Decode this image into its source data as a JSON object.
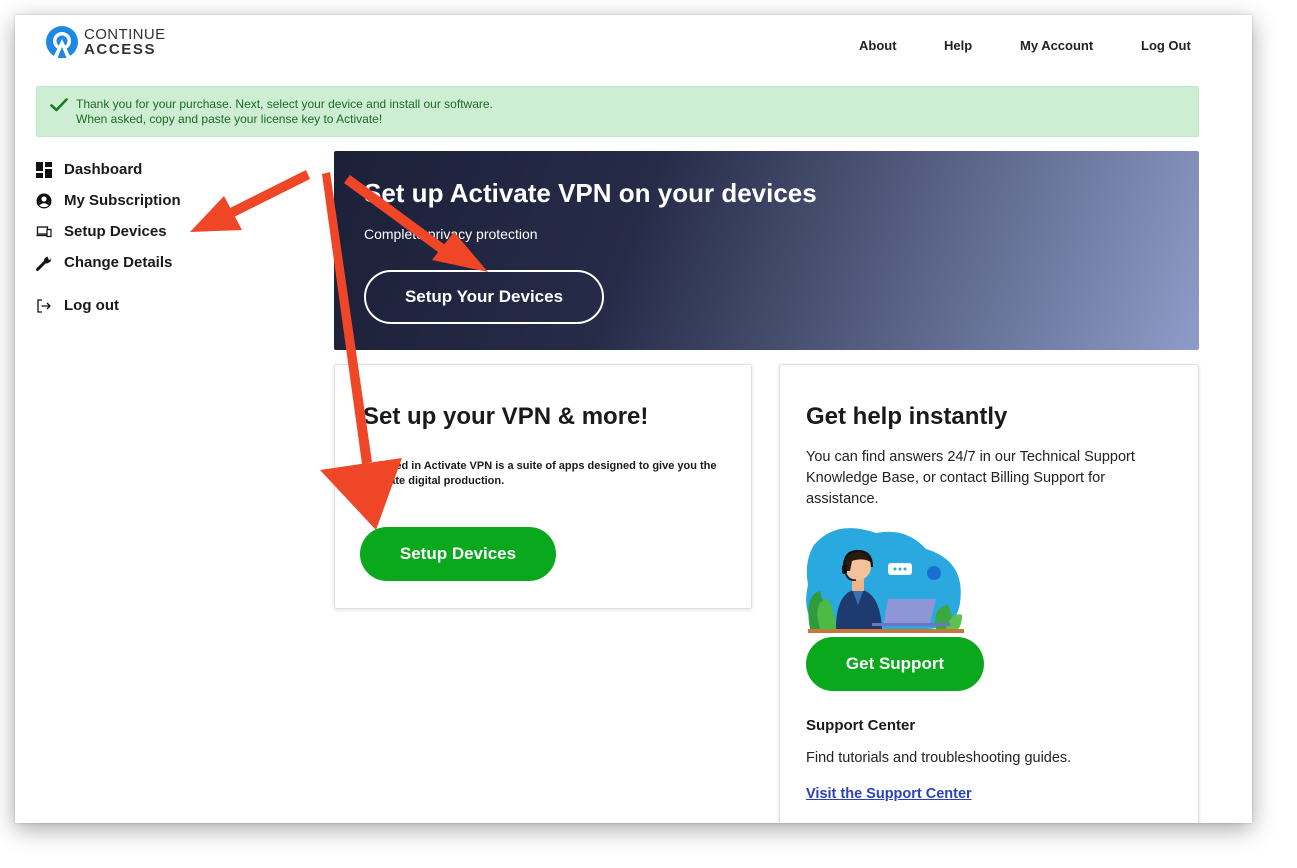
{
  "brand": {
    "line1": "CONTINUE",
    "line2": "ACCESS",
    "accent_color": "#1e88e5"
  },
  "top_nav": {
    "about": "About",
    "help": "Help",
    "my_account": "My Account",
    "log_out": "Log Out"
  },
  "alert": {
    "icon": "checkmark-icon",
    "line1": "Thank you for your purchase. Next, select your device and install our software.",
    "line2": "When asked, copy and paste your license key to Activate!",
    "color": "#cdeed3"
  },
  "sidebar": {
    "items": [
      {
        "label": "Dashboard",
        "icon": "dashboard-icon"
      },
      {
        "label": "My Subscription",
        "icon": "user-circle-icon"
      },
      {
        "label": "Setup Devices",
        "icon": "devices-icon"
      },
      {
        "label": "Change Details",
        "icon": "wrench-icon"
      },
      {
        "label": "Log out",
        "icon": "logout-icon"
      }
    ]
  },
  "hero": {
    "title": "Set up Activate VPN on your devices",
    "subtitle": "Complete privacy protection",
    "button": "Setup Your Devices"
  },
  "vpn_card": {
    "title": "Set up your VPN & more!",
    "description": "Included in Activate VPN is a suite of apps designed to give you the ultimate digital production.",
    "button": "Setup Devices"
  },
  "help_card": {
    "title": "Get help instantly",
    "description": "You can find answers 24/7 in our Technical Support Knowledge Base, or contact Billing Support for assistance.",
    "illustration": "support-agent-illustration",
    "button": "Get Support",
    "support_center_title": "Support Center",
    "support_center_desc": "Find tutorials and troubleshooting guides.",
    "support_center_link": "Visit the Support Center"
  },
  "colors": {
    "green_button": "#09a81d",
    "annotation_arrow": "#ee4627",
    "link": "#2a43b8"
  }
}
